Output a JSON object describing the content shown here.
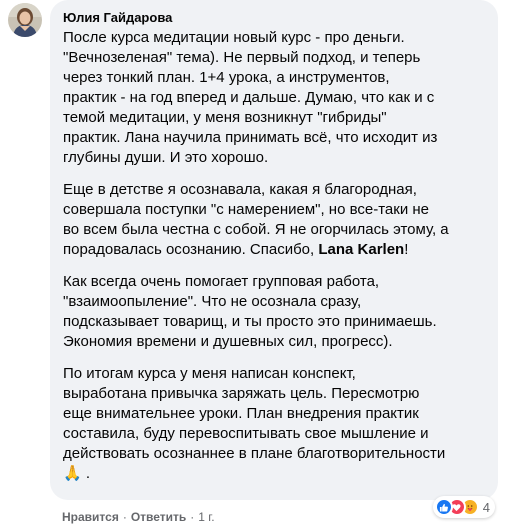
{
  "comment": {
    "author": "Юлия Гайдарова",
    "paragraphs": [
      "После курса медитации новый курс - про деньги.\n\"Вечнозеленая\" тема). Не первый подход, и теперь\nчерез тонкий план. 1+4 урока, а инструментов,\nпрактик - на год вперед и дальше. Думаю, что как и с\nтемой медитации, у меня возникнут \"гибриды\"\nпрактик. Лана научила принимать всё, что исходит из\nглубины души. И это хорошо.",
      "Как всегда очень помогает групповая работа,\n\"взаимоопыление\". Что не осознала сразу,\nподсказывает товарищ, и ты просто это принимаешь.\nЭкономия времени и душевных сил, прогресс).",
      "По итогам курса у меня написан конспект,\nвыработана привычка заряжать цель. Пересмотрю\nеще внимательнее уроки. План внедрения практик\nсоставила, буду перевоспитывать свое мышление и\nдействовать осознаннее в плане благотворительности"
    ],
    "paragraph2_before": "Еще в детстве я осознавала, какая я благородная,\nсовершала поступки \"с намерением\", но все-таки не\nво всем была честна с собой. Я не огорчилась этому, а\nпорадовалась осознанию. Спасибо, ",
    "mention": "Lana Karlen",
    "paragraph2_after": "!",
    "closing_emoji": "🙏",
    "closing_dot": "."
  },
  "reactions": {
    "icons": [
      "like-icon",
      "love-icon",
      "care-icon"
    ],
    "count": "4"
  },
  "actions": {
    "like": "Нравится",
    "reply": "Ответить",
    "separator": "·",
    "time": "1 г."
  },
  "colors": {
    "bubble": "#f0f2f5",
    "text": "#050505",
    "secondary": "#65676b",
    "like": "#1877f2",
    "love": "#f33e58",
    "care": "#f7b125"
  }
}
